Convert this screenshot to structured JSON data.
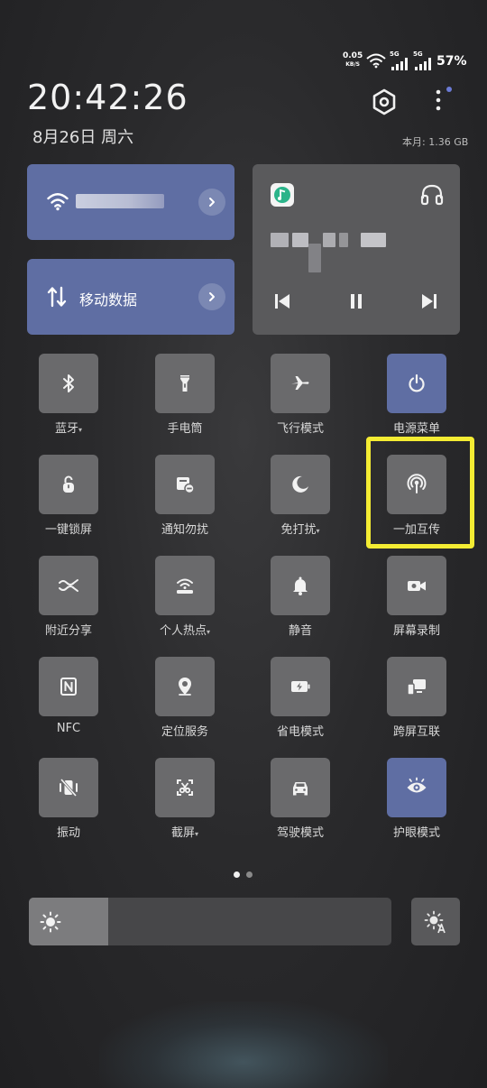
{
  "status_bar": {
    "net_speed_value": "0.05",
    "net_speed_unit": "KB/S",
    "network_1": "5G",
    "network_2": "5G",
    "battery": "57%"
  },
  "header": {
    "time": "20:42:26",
    "date": "8月26日 周六",
    "data_usage": "本月: 1.36 GB"
  },
  "cards": {
    "wifi": {
      "icon": "wifi-icon"
    },
    "mobile_data": {
      "label": "移动数据",
      "icon": "mobile-data-icon"
    },
    "media": {
      "app_icon": "music-app-icon"
    }
  },
  "tiles": [
    {
      "label": "蓝牙",
      "icon": "bluetooth-icon",
      "caret": "▾",
      "active": false
    },
    {
      "label": "手电筒",
      "icon": "flashlight-icon",
      "caret": "",
      "active": false
    },
    {
      "label": "飞行模式",
      "icon": "airplane-icon",
      "caret": "",
      "active": false
    },
    {
      "label": "电源菜单",
      "icon": "power-icon",
      "caret": "",
      "active": true
    },
    {
      "label": "一键锁屏",
      "icon": "lock-icon",
      "caret": "",
      "active": false
    },
    {
      "label": "通知勿扰",
      "icon": "notification-block-icon",
      "caret": "",
      "active": false
    },
    {
      "label": "免打扰",
      "icon": "moon-icon",
      "caret": "▾",
      "active": false
    },
    {
      "label": "一加互传",
      "icon": "broadcast-icon",
      "caret": "",
      "active": false
    },
    {
      "label": "附近分享",
      "icon": "nearby-share-icon",
      "caret": "",
      "active": false
    },
    {
      "label": "个人热点",
      "icon": "hotspot-icon",
      "caret": "▾",
      "active": false
    },
    {
      "label": "静音",
      "icon": "bell-icon",
      "caret": "",
      "active": false
    },
    {
      "label": "屏幕录制",
      "icon": "screen-record-icon",
      "caret": "",
      "active": false
    },
    {
      "label": "NFC",
      "icon": "nfc-icon",
      "caret": "",
      "active": false
    },
    {
      "label": "定位服务",
      "icon": "location-icon",
      "caret": "",
      "active": false
    },
    {
      "label": "省电模式",
      "icon": "battery-saver-icon",
      "caret": "",
      "active": false
    },
    {
      "label": "跨屏互联",
      "icon": "multi-screen-icon",
      "caret": "",
      "active": false
    },
    {
      "label": "振动",
      "icon": "vibrate-off-icon",
      "caret": "",
      "active": false
    },
    {
      "label": "截屏",
      "icon": "screenshot-icon",
      "caret": "▾",
      "active": false
    },
    {
      "label": "驾驶模式",
      "icon": "car-icon",
      "caret": "",
      "active": false
    },
    {
      "label": "护眼模式",
      "icon": "eye-icon",
      "caret": "",
      "active": true
    }
  ],
  "pager": {
    "current": 1,
    "total": 2
  },
  "brightness": {
    "level": 0.22
  },
  "colors": {
    "accent": "#5f6ea3",
    "highlight": "#f4ec33",
    "tile": "#6a6a6c"
  }
}
